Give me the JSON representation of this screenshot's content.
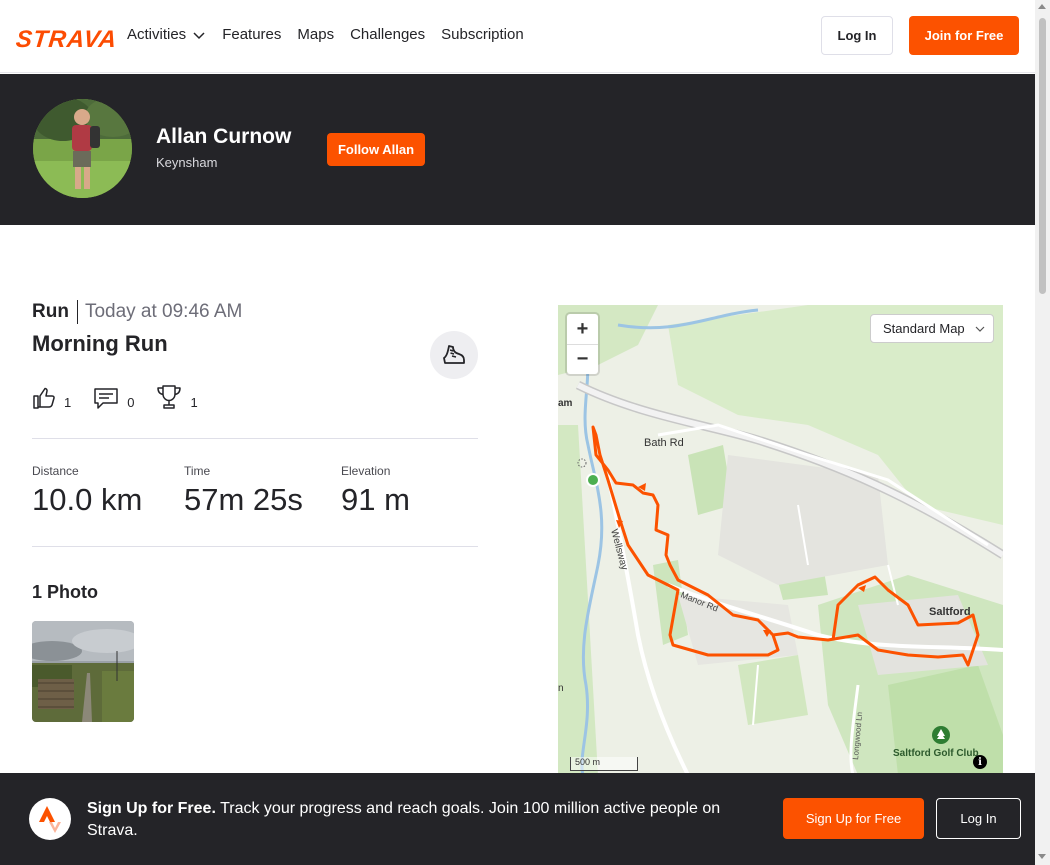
{
  "nav": {
    "logo": "STRAVA",
    "links": [
      "Activities",
      "Features",
      "Maps",
      "Challenges",
      "Subscription"
    ],
    "login": "Log In",
    "join": "Join for Free"
  },
  "athlete": {
    "name": "Allan Curnow",
    "location": "Keynsham",
    "follow": "Follow Allan"
  },
  "activity": {
    "type": "Run",
    "date": "Today at 09:46 AM",
    "title": "Morning Run",
    "kudos": "1",
    "comments": "0",
    "achievements": "1",
    "stats": [
      {
        "label": "Distance",
        "value": "10.0 km"
      },
      {
        "label": "Time",
        "value": "57m 25s"
      },
      {
        "label": "Elevation",
        "value": "91 m"
      }
    ],
    "photos_heading": "1 Photo"
  },
  "map": {
    "style": "Standard Map",
    "zoom_in": "+",
    "zoom_out": "−",
    "scale": "500 m",
    "labels": {
      "bath_rd": "Bath Rd",
      "wellsway": "Wellsway",
      "manor_rd": "Manor Rd",
      "saltford": "Saltford",
      "golf": "Saltford Golf Club",
      "longwood": "Longwood Ln",
      "edge_am": "am",
      "edge_n": "n"
    },
    "route_color": "#fc5200"
  },
  "signup": {
    "headline": "Sign Up for Free.",
    "text": "Track your progress and reach goals. Join 100 million active people on Strava.",
    "signup_btn": "Sign Up for Free",
    "login_btn": "Log In"
  }
}
